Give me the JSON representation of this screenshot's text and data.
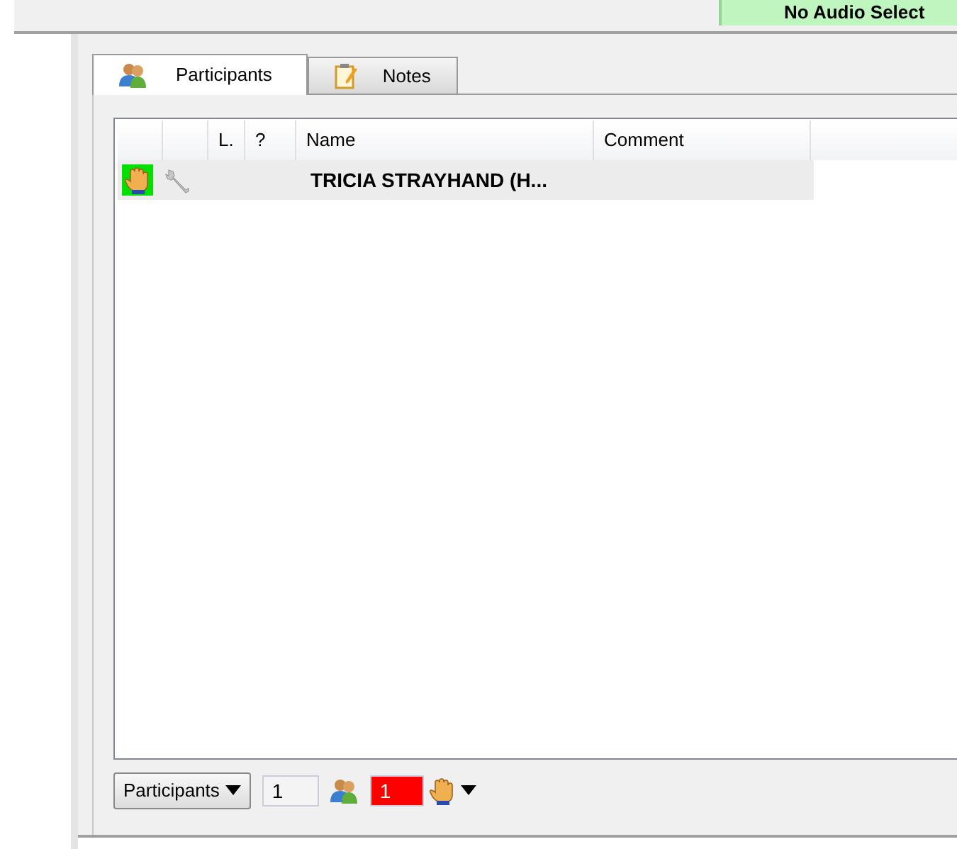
{
  "audio_status": "No Audio Select",
  "tabs": [
    {
      "label": "Participants",
      "kind": "people",
      "selected": true
    },
    {
      "label": "Notes",
      "kind": "notepad",
      "selected": false
    }
  ],
  "table": {
    "columns": [
      "L.",
      "?",
      "Name",
      "Comment"
    ],
    "rows": [
      {
        "hand_raised": true,
        "name": "TRICIA STRAYHAND (H..."
      }
    ]
  },
  "footer": {
    "view_button": "Participants",
    "participant_count": "1",
    "hand_count": "1"
  }
}
